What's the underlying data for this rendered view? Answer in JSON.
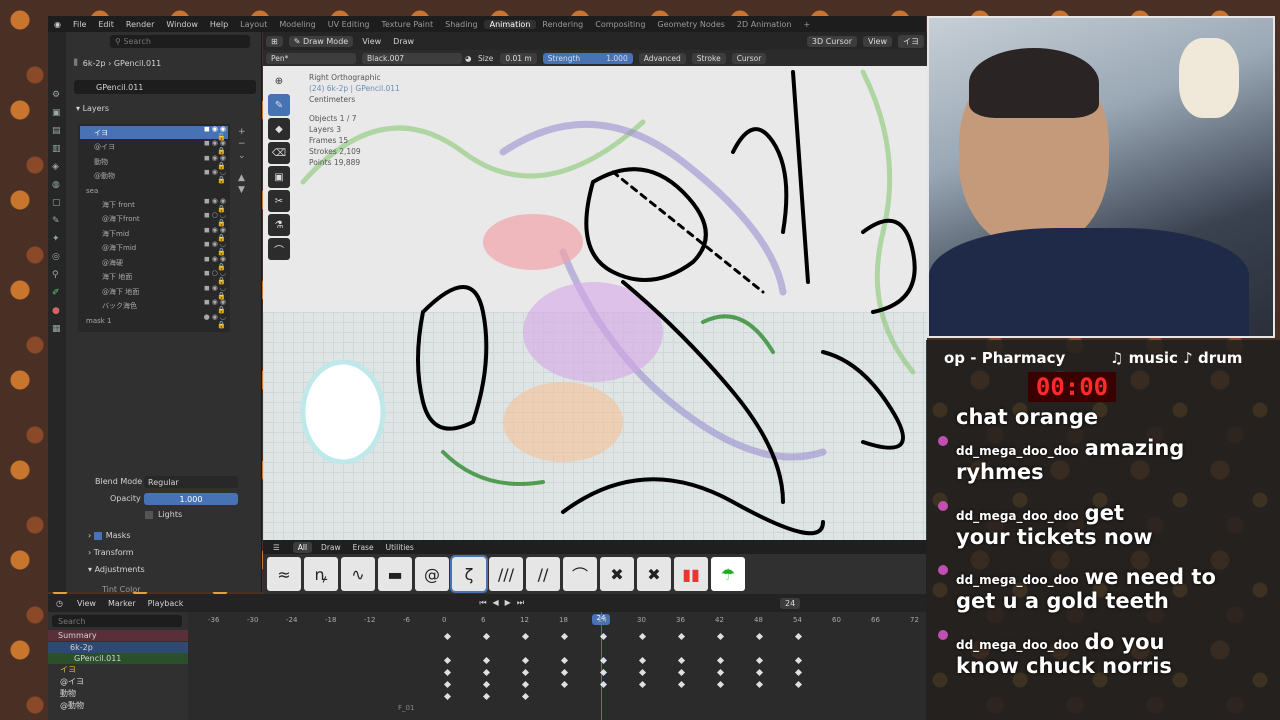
{
  "top_menu": {
    "items": [
      "File",
      "Edit",
      "Render",
      "Window",
      "Help"
    ],
    "workspaces": [
      "Layout",
      "Modeling",
      "UV Editing",
      "Texture Paint",
      "Shading",
      "Animation",
      "Rendering",
      "Compositing",
      "Geometry Nodes",
      "2D Animation"
    ],
    "active_workspace": "Animation"
  },
  "left_panel": {
    "search_placeholder": "Search",
    "breadcrumb_scene": "6k-2p",
    "breadcrumb_object": "GPencil.011",
    "object_name": "GPencil.011",
    "section_layers": "Layers",
    "layers": [
      "イヨ",
      "@イヨ",
      "動物",
      "@動物",
      "sea",
      "海下 front",
      "@海下front",
      "海下mid",
      "@海下mid",
      "@海硬",
      "海下 地面",
      "@海下 地面",
      "バック海色",
      "mask 1"
    ],
    "blend_mode_label": "Blend Mode",
    "blend_mode_value": "Regular",
    "opacity_label": "Opacity",
    "opacity_value": "1.000",
    "lights_label": "Lights",
    "masks_label": "Masks",
    "transform_label": "Transform",
    "adjustments_label": "Adjustments",
    "tint_label": "Tint Color"
  },
  "viewport": {
    "mode": "Draw Mode",
    "menu_view": "View",
    "menu_draw": "Draw",
    "cursor_mode": "3D Cursor",
    "view_btn": "View",
    "layer_btn": "イヨ",
    "brush_name": "Pen*",
    "material": "Black.007",
    "size_label": "Size",
    "size_value": "0.01 m",
    "strength_label": "Strength",
    "strength_value": "1.000",
    "advanced": "Advanced",
    "stroke": "Stroke",
    "cursor": "Cursor",
    "info": {
      "view": "Right Orthographic",
      "frame_obj": "(24) 6k-2p | GPencil.011",
      "units": "Centimeters",
      "objects": "Objects   1 / 7",
      "layers": "Layers   3",
      "frames": "Frames   15",
      "strokes": "Strokes   2,109",
      "points": "Points   19,889"
    }
  },
  "brush_tabs": [
    "All",
    "Draw",
    "Erase",
    "Utilities"
  ],
  "dopesheet": {
    "view": "View",
    "marker": "Marker",
    "playback": "Playback",
    "search": "Search",
    "current_frame": "24",
    "frames": [
      "-36",
      "-30",
      "-24",
      "-18",
      "-12",
      "-6",
      "0",
      "6",
      "12",
      "18",
      "24",
      "30",
      "36",
      "42",
      "48",
      "54",
      "60",
      "66",
      "72"
    ],
    "channels": [
      "Summary",
      "6k-2p",
      "GPencil.011",
      "イヨ",
      "@イヨ",
      "動物",
      "@動物"
    ],
    "frame_marker": "F_01"
  },
  "overlay": {
    "song": "op - Pharmacy",
    "music": "♫ music ♪ drum",
    "timer": "00:00",
    "messages": [
      {
        "user": "",
        "text": "chat orange"
      },
      {
        "user": "dd_mega_doo_doo",
        "text": "amazing ryhmes"
      },
      {
        "user": "dd_mega_doo_doo",
        "text": "get your tickets now"
      },
      {
        "user": "dd_mega_doo_doo",
        "text": "we need to get u a gold teeth"
      },
      {
        "user": "dd_mega_doo_doo",
        "text": "do you know chuck norris"
      }
    ]
  }
}
